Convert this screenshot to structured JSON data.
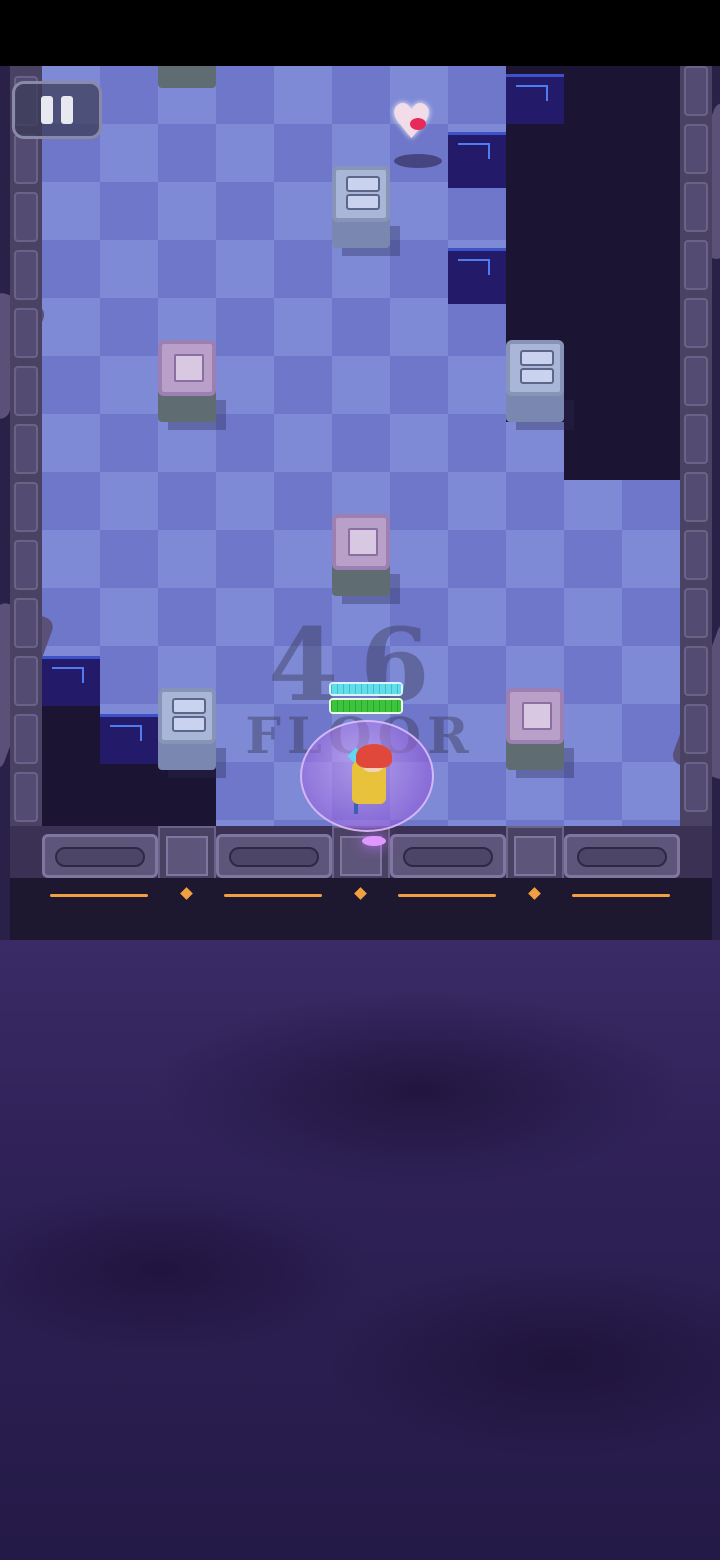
{
  "game": {
    "floor_number": "46",
    "floor_label": "FLOOR",
    "player": {
      "shield_fill_percent": 100,
      "health_fill_percent": 100,
      "has_bubble_shield": true
    },
    "pickups": [
      {
        "type": "heart",
        "icon": "heart-icon"
      }
    ],
    "obstacles": {
      "purple_blocks": 4,
      "grey_cabinet_blocks": 3,
      "pits": 2
    }
  },
  "hud": {
    "pause_icon": "pause-icon"
  },
  "colors": {
    "floor_light": "#7f8ad6",
    "floor_dark": "#6e77c9",
    "void": "#2e2156",
    "shield_bar": "#5ee0ec",
    "health_bar": "#3cc43c",
    "accent_orange": "#f0a040",
    "pit_rune": "#4f7cf0"
  }
}
